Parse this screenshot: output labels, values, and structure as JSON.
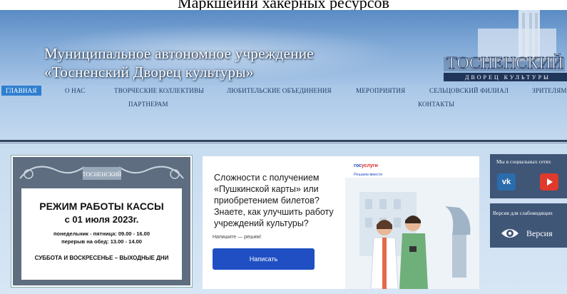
{
  "page": {
    "top_caption": "Маркшейни хакерных ресурсов"
  },
  "header": {
    "title_line1": "Муниципальное автономное учреждение",
    "title_line2": "«Тосненский Дворец культуры»",
    "logo_text_main": "ТОСНЕНСКИЙ",
    "logo_text_sub": "ДВОРЕЦ КУЛЬТУРЫ"
  },
  "nav": {
    "items": [
      {
        "label": "ГЛАВНАЯ",
        "active": true
      },
      {
        "label": "О НАС"
      },
      {
        "label": "ТВОРЧЕСКИЕ КОЛЛЕКТИВЫ"
      },
      {
        "label": "ЛЮБИТЕЛЬСКИЕ ОБЪЕДИНЕНИЯ"
      },
      {
        "label": "МЕРОПРИЯТИЯ"
      },
      {
        "label": "СЕЛЬЦОВСКИЙ ФИЛИАЛ"
      },
      {
        "label": "ЗРИТЕЛЯМ"
      },
      {
        "label": "ПАРТНЕРАМ"
      },
      {
        "label": "КОНТАКТЫ"
      }
    ]
  },
  "kassa": {
    "sign_text": "ТОСНЕНСКИЙ",
    "title": "РЕЖИМ РАБОТЫ КАССЫ",
    "date": "с 01 июля 2023г.",
    "hours": "понедельник - пятница: 09.00 - 16.00",
    "lunch": "перерыв на обед: 13.00 - 14.00",
    "weekend": "СУББОТА И ВОСКРЕСЕНЬЕ – ВЫХОДНЫЕ ДНИ"
  },
  "gosuslugi": {
    "brand_prefix": "гос",
    "brand_suffix": "услуги",
    "tagline": "Решаем вместе",
    "question": "Сложности с получением «Пушкинской карты» или приобретением билетов? Знаете, как улучшить работу учреждений культуры?",
    "hint": "Напишите — решим!",
    "button_label": "Написать"
  },
  "social": {
    "title": "Мы в социальных сетях",
    "vk_label": "vk",
    "youtube_icon": "youtube-icon"
  },
  "vision": {
    "title": "Версия для слабовидящих",
    "label": "Версия"
  },
  "colors": {
    "nav_active": "#2f7fd0",
    "sidebar_panel": "#3f5677",
    "gos_button": "#1f4fc2"
  }
}
